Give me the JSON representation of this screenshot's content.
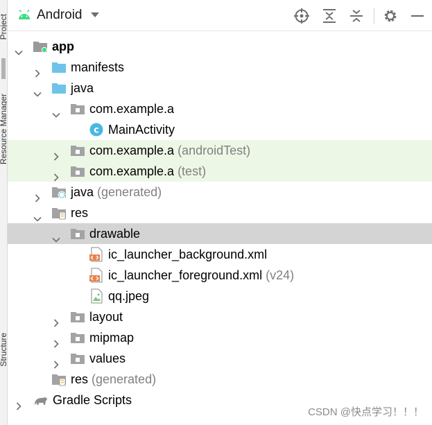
{
  "side_tabs": {
    "project": "Project",
    "resource_manager": "Resource Manager",
    "structure": "Structure"
  },
  "toolbar": {
    "view_label": "Android",
    "buttons": [
      "crosshair-icon",
      "expand-all-icon",
      "collapse-all-icon",
      "gear-icon",
      "minimize-icon"
    ]
  },
  "tree": [
    {
      "label": "app",
      "suffix": "",
      "level": 0,
      "arrow": "down",
      "icon": "module-folder-icon",
      "bold": true
    },
    {
      "label": "manifests",
      "suffix": "",
      "level": 1,
      "arrow": "right",
      "icon": "blue-folder-icon"
    },
    {
      "label": "java",
      "suffix": "",
      "level": 1,
      "arrow": "down",
      "icon": "blue-folder-icon"
    },
    {
      "label": "com.example.a",
      "suffix": "",
      "level": 2,
      "arrow": "down",
      "icon": "package-icon"
    },
    {
      "label": "MainActivity",
      "suffix": "",
      "level": 3,
      "arrow": "none",
      "icon": "class-icon"
    },
    {
      "label": "com.example.a",
      "suffix": " (androidTest)",
      "level": 2,
      "arrow": "right",
      "icon": "package-icon",
      "test": true
    },
    {
      "label": "com.example.a",
      "suffix": " (test)",
      "level": 2,
      "arrow": "right",
      "icon": "package-icon",
      "test": true
    },
    {
      "label": "java",
      "suffix": " (generated)",
      "level": 1,
      "arrow": "right",
      "icon": "generated-folder-icon"
    },
    {
      "label": "res",
      "suffix": "",
      "level": 1,
      "arrow": "down",
      "icon": "res-folder-icon"
    },
    {
      "label": "drawable",
      "suffix": "",
      "level": 2,
      "arrow": "down",
      "icon": "package-icon",
      "selected": true
    },
    {
      "label": "ic_launcher_background.xml",
      "suffix": "",
      "level": 3,
      "arrow": "none",
      "icon": "xml-file-icon"
    },
    {
      "label": "ic_launcher_foreground.xml",
      "suffix": " (v24)",
      "level": 3,
      "arrow": "none",
      "icon": "xml-file-icon"
    },
    {
      "label": "qq.jpeg",
      "suffix": "",
      "level": 3,
      "arrow": "none",
      "icon": "image-file-icon"
    },
    {
      "label": "layout",
      "suffix": "",
      "level": 2,
      "arrow": "right",
      "icon": "package-icon"
    },
    {
      "label": "mipmap",
      "suffix": "",
      "level": 2,
      "arrow": "right",
      "icon": "package-icon"
    },
    {
      "label": "values",
      "suffix": "",
      "level": 2,
      "arrow": "right",
      "icon": "package-icon"
    },
    {
      "label": "res",
      "suffix": " (generated)",
      "level": 1,
      "arrow": "none",
      "icon": "res-folder-icon"
    },
    {
      "label": "Gradle Scripts",
      "suffix": "",
      "level": 0,
      "arrow": "right",
      "icon": "gradle-icon",
      "rootless": true
    }
  ],
  "watermark": "CSDN @快点学习！！！",
  "colors": {
    "android_green": "#3ddc84",
    "folder_blue": "#6fc3e8",
    "package_gray": "#a3a3a3",
    "class_cyan": "#49b7e3",
    "xml_orange": "#e8834e",
    "test_green_bg": "#edf7e6",
    "selection_gray": "#d4d4d4"
  }
}
